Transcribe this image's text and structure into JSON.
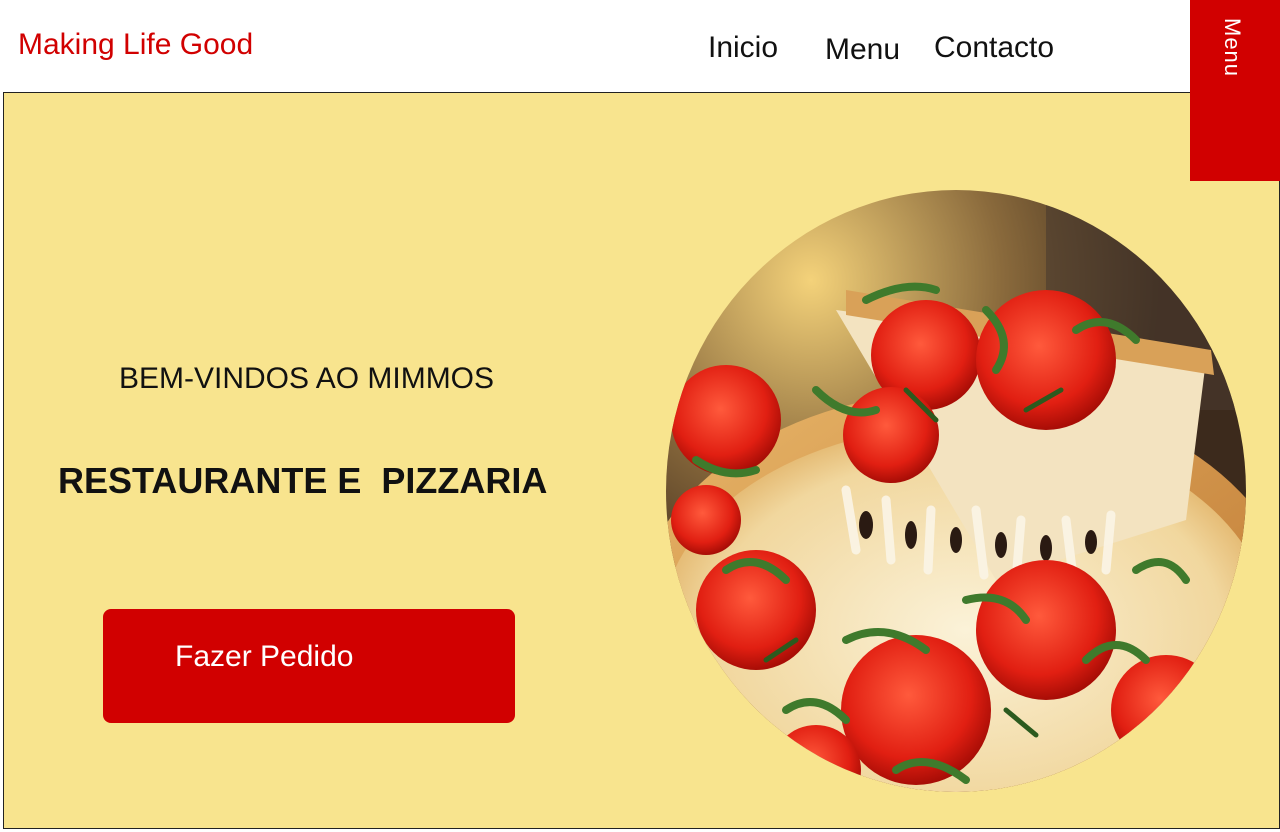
{
  "header": {
    "brand": "Making Life Good",
    "nav": {
      "inicio": "Inicio",
      "menu": "Menu",
      "contacto": "Contacto"
    },
    "side_tab_label": "Menu"
  },
  "hero": {
    "welcome": "BEM-VINDOS AO MIMMOS",
    "headline": "RESTAURANTE E  PIZZARIA",
    "order_button": "Fazer Pedido",
    "image": "pizza-photo"
  },
  "colors": {
    "accent": "#d10000",
    "hero_background": "#f8e48e"
  }
}
